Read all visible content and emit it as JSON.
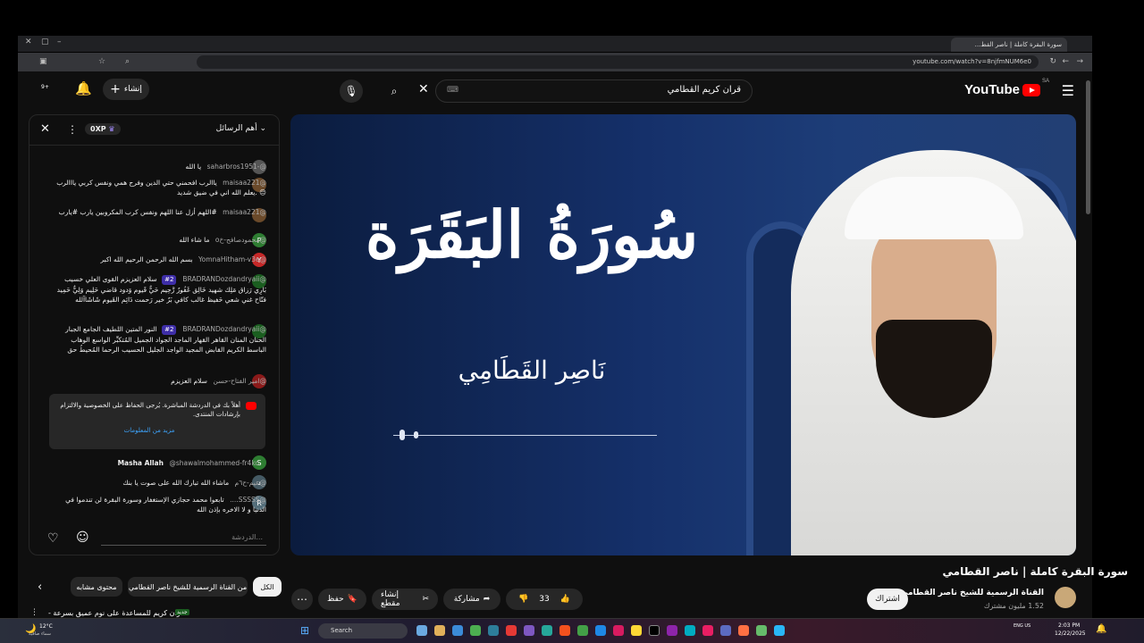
{
  "browser": {
    "tab_title": "سورة البقرة كاملة | ناصر القط...",
    "url": "youtube.com/watch?v=8njfmNUM6e0"
  },
  "header": {
    "logo_text": "YouTube",
    "logo_region": "SA",
    "search_value": "قران كريم القطامي",
    "create_label": "إنشاء",
    "notification_count": "9+"
  },
  "chat": {
    "mode_label": "أهم الرسائل",
    "points_label": "0XP",
    "messages": [
      {
        "author": "@-saharbros1951",
        "text": "يا الله",
        "avatar_letter": "",
        "avatar_color": "#555555"
      },
      {
        "author": "@maisaa221",
        "text": "ياالرب افحمني حتي الدين وفرج همي ونفس كربي يااالرب 😔 .يعلم الله اني في ضيق شديد",
        "avatar_letter": "",
        "avatar_color": "#6b4a2a"
      },
      {
        "author": "@maisaa221",
        "text": "#اللهم أزل عنا اللهم ونفس كرب المكروبين يارب #يارب",
        "avatar_letter": "",
        "avatar_color": "#6b4a2a"
      },
      {
        "author": "@محمودصافح-خo",
        "text": "ما شاء الله",
        "avatar_letter": "P",
        "avatar_color": "#2e7d32"
      },
      {
        "author": "@YomnaHitham-v3e",
        "text": "بسم الله الرحمن الرحيم الله اكبر",
        "avatar_letter": "Y",
        "avatar_color": "#c62828"
      },
      {
        "author": "@BRADRANDozdandryaii",
        "badge": "#2",
        "text": "سلام العزيزم القوى العلي خسيب بَارِي رَزاق مَلِك شهيد خَالِق غَفُورٌ رَّحِيم حَيٌّ قَيوم وَدود قاضي حَلِيم وَلِيٌّ حَمِيد فتّاح غني شعي حَفيظ غالب كافي بَرٌ خير رَحمت دَائِم القَيوم شَاشَاآلله",
        "avatar_letter": "",
        "avatar_color": "#1b5e20"
      },
      {
        "author": "@BRADRANDozdandryaii",
        "badge": "#2",
        "text": "النور المتين اللطيف الجامع الجبار الحنان المنان القاهر القهار الماجد الجواد الجميل المُتكبِّر الواسع الوهاب الباسط الكريم القابض المجيد الواجد الجليل الحسيب الرحما المُحيطُ حق",
        "avatar_letter": "",
        "avatar_color": "#1b5e20"
      },
      {
        "author": "@امير الفتاح-حسن",
        "text": "سلام العزيزم",
        "avatar_letter": "",
        "avatar_color": "#8b1a1a"
      }
    ],
    "notice": {
      "text": "أهلاً بك في الدردشة المباشرة. يُرجى الحفاظ على الخصوصية والالتزام بإرشادات المنتدى.",
      "link": "مزيد من المعلومات"
    },
    "messages_after": [
      {
        "author": "@shawalmohammed-fr4ko",
        "text": "Masha Allah",
        "avatar_letter": "S",
        "avatar_color": "#2e7d32"
      },
      {
        "author": "@عيم-ح٦م",
        "text": "ماشاء الله تبارك الله على صوت يا بنك",
        "avatar_letter": "د",
        "avatar_color": "#455a64"
      },
      {
        "author": "@SSSSS....",
        "text": "تابعوا محمد حجازي الإستغفار وسورة البقرة لن تندموا في الدنيا و لا الاخره بإذن الله",
        "avatar_letter": "R",
        "avatar_color": "#546e7a"
      }
    ],
    "input_placeholder": "الدردشة..."
  },
  "video": {
    "calligraphy_title": "سُورَةُ البَقَرَة",
    "calligraphy_reciter": "نَاصِر القَطَامِي",
    "title": "سورة البقرة كاملة | ناصر القطامي",
    "channel_name": "القناة الرسمية للشيخ ناصر القطامي",
    "subscribers": "1.52 مليون مشترك",
    "subscribe_label": "اشتراك",
    "likes": "33",
    "share_label": "مشاركة",
    "clip_label": "إنشاء مقطع",
    "save_label": "حفظ"
  },
  "chips": [
    "الكل",
    "من القناة الرسمية للشيخ ناصر القطامي",
    "محتوى مشابه"
  ],
  "next_video": {
    "title": "قران كريم للمساعدة على نوم عميق بسرعة -",
    "badge": "جديد"
  },
  "taskbar": {
    "weather_temp": "12°C",
    "weather_desc": "سماء صافية",
    "search_label": "Search",
    "time": "2:03 PM",
    "date": "12/22/2025",
    "lang": "ENG US"
  }
}
